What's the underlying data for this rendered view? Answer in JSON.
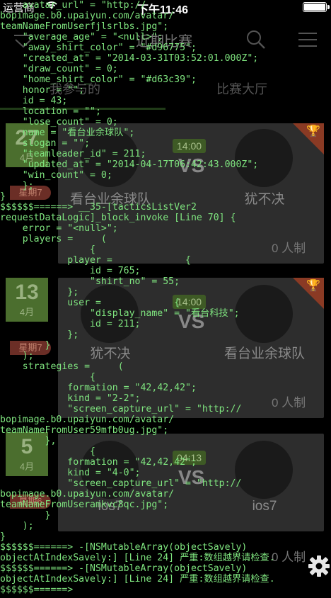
{
  "status_bar": {
    "carrier": "运营商",
    "time": "下午11:46"
  },
  "nav": {
    "title": "近期比赛"
  },
  "tabs": {
    "left": "我参与的",
    "right": "比赛大厅"
  },
  "matches": [
    {
      "day": "27",
      "month": "4月",
      "weekday": "星期7",
      "team_a": "看台业余球队",
      "team_b": "犹不决",
      "time": "14:00",
      "vs": "VS",
      "people": "0 人制"
    },
    {
      "day": "13",
      "month": "4月",
      "weekday": "星期7",
      "team_a": "犹不决",
      "team_b": "看台业余球队",
      "time": "14:00",
      "vs": "VS",
      "people": "0 人制"
    },
    {
      "day": "5",
      "month": "4月",
      "weekday": "星期6",
      "team_a": "ios7",
      "team_b": "ios7",
      "time": "04:13",
      "vs": "VS",
      "people": "0 人制"
    }
  ],
  "colors": {
    "log_text": "#7fe57f",
    "date_bg": "#4b6e2e",
    "weekday_bg": "#6b2e26",
    "card_bg": "#2d2d2d"
  },
  "log_lines": [
    "    avatar_url\" = \"http://",
    "bopimage.b0.upaiyun.com/avatar/",
    "teamNameFromUserfjlsrlbs.jpg\";",
    "    \"average_age\" = \"<null>\";",
    "    \"away_shirt_color\" = \"#d96775\";",
    "    \"created_at\" = \"2014-03-31T03:52:01.000Z\";",
    "    \"draw_count\" = 0;",
    "    \"home_shirt_color\" = \"#d63c39\";",
    "    honor = \"\";",
    "    id = 43;",
    "    location = \"\";",
    "    \"lose_count\" = 0;",
    "    name = \"看台业余球队\";",
    "    slogan = \"\";",
    "    \"teamleader_id\" = 211;",
    "    \"updated_at\" = \"2014-04-17T06:42:43.000Z\";",
    "    \"win_count\" = 0;",
    "    };",
    "}",
    "$$$$$$======> __35-[tacticsListVer2",
    "requestDataLogic]_block_invoke [Line 70] {",
    "    error = \"<null>\";",
    "    players =     (",
    "                {",
    "            player =             {",
    "                id = 765;",
    "                \"shirt_no\" = 55;",
    "            };",
    "            user =             {",
    "                \"display_name\" = \"看台科技\";",
    "                id = 211;",
    "            };",
    "        }",
    "    );",
    "    strategies =     (",
    "                {",
    "            formation = \"42,42,42\";",
    "            kind = \"2-2\";",
    "            \"screen_capture_url\" = \"http://",
    "bopimage.b0.upaiyun.com/avatar/",
    "teamNameFromUser59mfb0ug.jpg\";",
    "        },",
    "                {",
    "            formation = \"42,42,42\";",
    "            kind = \"4-0\";",
    "            \"screen_capture_url\" = \"http://",
    "bopimage.b0.upaiyun.com/avatar/",
    "teamNameFromUseramkvc8qc.jpg\";",
    "        }",
    "    );",
    "}",
    "$$$$$$======> -[NSMutableArray(objectSavely)",
    "objectAtIndexSavely:] [Line 24] 严重:数组越界请检查.",
    "$$$$$$======> -[NSMutableArray(objectSavely)",
    "objectAtIndexSavely:] [Line 24] 严重:数组越界请检查.",
    "$$$$$$======>"
  ]
}
